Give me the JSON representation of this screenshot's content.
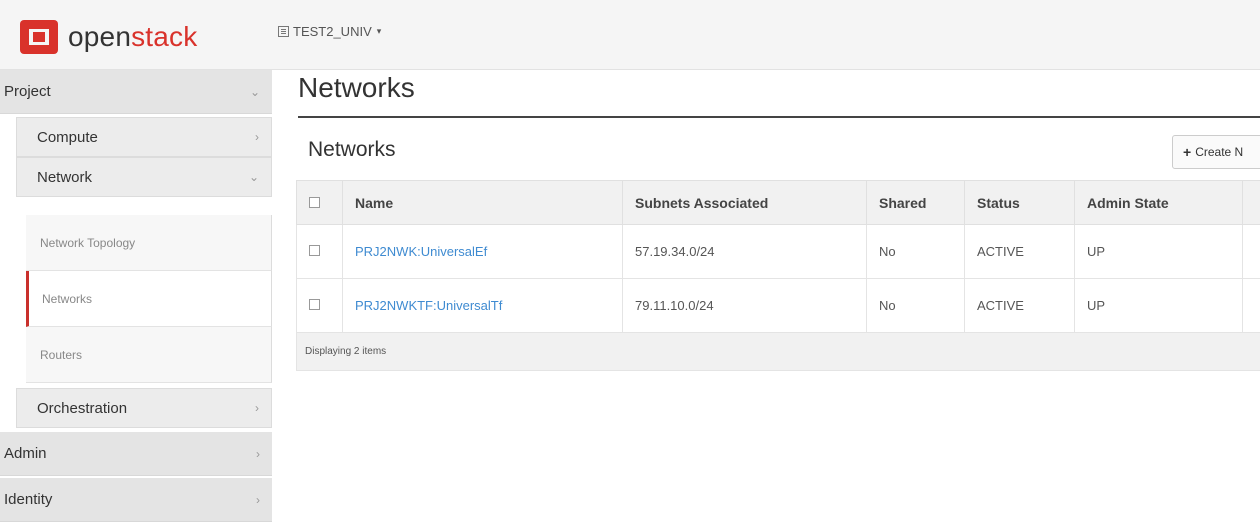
{
  "brand": {
    "part1": "open",
    "part2": "stack"
  },
  "project_switcher": {
    "label": "TEST2_UNIV",
    "caret": "▾"
  },
  "sidebar": {
    "project": {
      "label": "Project",
      "chev": "⌄"
    },
    "compute": {
      "label": "Compute",
      "chev": "›"
    },
    "network": {
      "label": "Network",
      "chev": "⌄"
    },
    "items": [
      {
        "label": "Network Topology"
      },
      {
        "label": "Networks"
      },
      {
        "label": "Routers"
      }
    ],
    "orchestration": {
      "label": "Orchestration",
      "chev": "›"
    },
    "admin": {
      "label": "Admin",
      "chev": "›"
    },
    "identity": {
      "label": "Identity",
      "chev": "›"
    }
  },
  "page": {
    "title": "Networks",
    "section_title": "Networks"
  },
  "toolbar": {
    "create_label": "Create N"
  },
  "table": {
    "columns": [
      "Name",
      "Subnets Associated",
      "Shared",
      "Status",
      "Admin State"
    ],
    "rows": [
      {
        "name": "PRJ2NWK:UniversalEf",
        "subnets": "57.19.34.0/24",
        "shared": "No",
        "status": "ACTIVE",
        "admin_state": "UP"
      },
      {
        "name": "PRJ2NWKTF:UniversalTf",
        "subnets": "79.11.10.0/24",
        "shared": "No",
        "status": "ACTIVE",
        "admin_state": "UP"
      }
    ],
    "footer": "Displaying 2 items"
  },
  "colors": {
    "accent": "#d9322b",
    "link": "#3f8bd1"
  }
}
